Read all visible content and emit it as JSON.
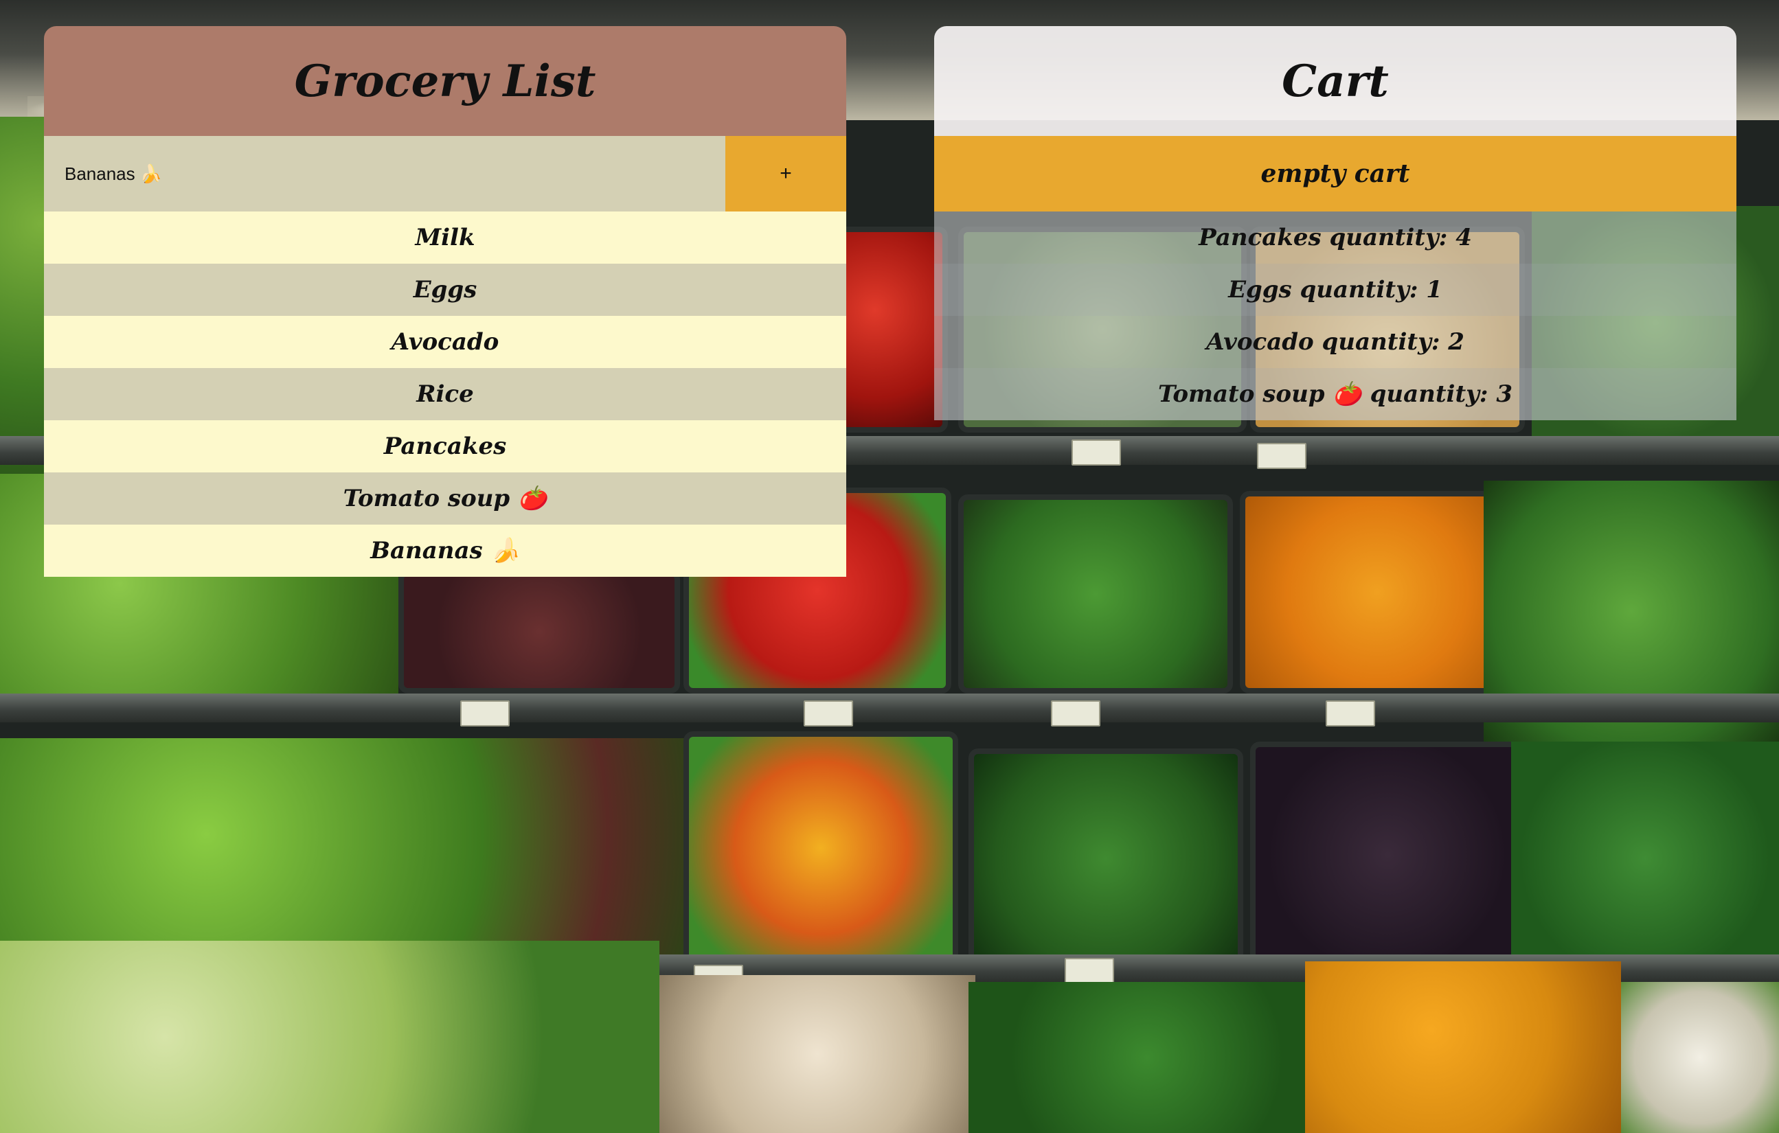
{
  "grocery": {
    "title": "Grocery List",
    "input_value": "Bananas 🍌",
    "add_label": "+",
    "items": [
      "Milk",
      "Eggs",
      "Avocado",
      "Rice",
      "Pancakes",
      "Tomato soup 🍅",
      "Bananas 🍌"
    ]
  },
  "cart": {
    "title": "Cart",
    "empty_label": "empty cart",
    "quantity_label": "quantity:",
    "items": [
      {
        "name": "Pancakes",
        "quantity": "4"
      },
      {
        "name": "Eggs",
        "quantity": "1"
      },
      {
        "name": "Avocado",
        "quantity": "2"
      },
      {
        "name": "Tomato soup 🍅",
        "quantity": "3"
      }
    ]
  },
  "colors": {
    "grocery_header": "#ad7b6a",
    "accent_button": "#e8a82f",
    "row_light": "#fdf9cc",
    "row_dark": "#d4d0b4"
  }
}
